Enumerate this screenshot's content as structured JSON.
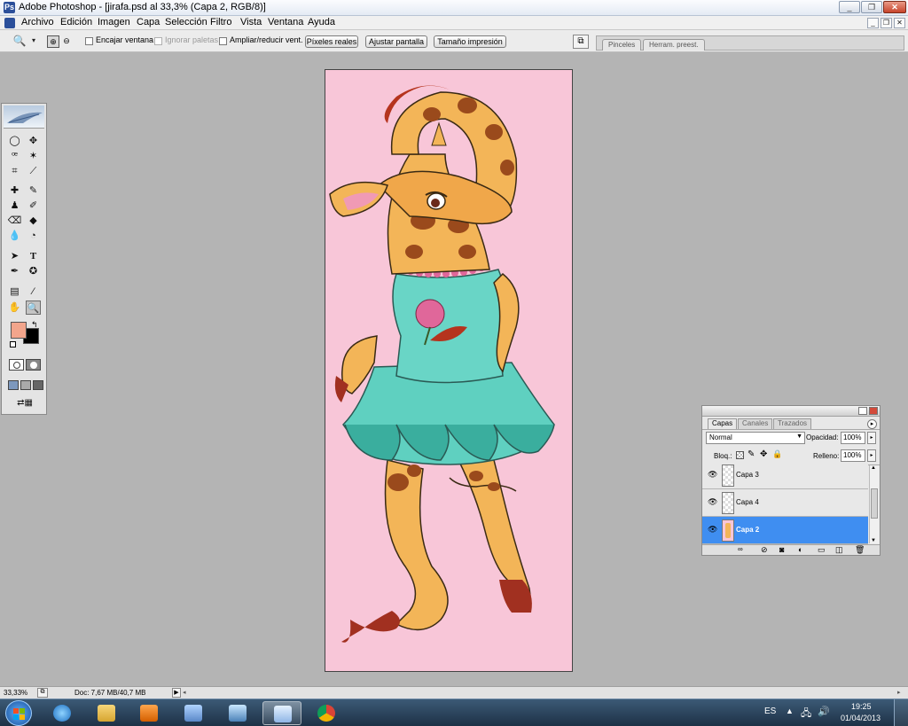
{
  "window": {
    "title": "Adobe Photoshop - [jirafa.psd al 33,3% (Capa 2, RGB/8)]",
    "buttons": {
      "minimize": "_",
      "restore": "❐",
      "close": "✕"
    }
  },
  "menubar": {
    "items": [
      "Archivo",
      "Edición",
      "Imagen",
      "Capa",
      "Selección",
      "Filtro",
      "Vista",
      "Ventana",
      "Ayuda"
    ],
    "doc_buttons": {
      "minimize": "_",
      "restore": "❐",
      "close": "✕"
    }
  },
  "options_bar": {
    "encajar_ventana": "Encajar ventana",
    "ignorar_paletas": "Ignorar paletas",
    "ampliar_reducir": "Ampliar/reducir vent.",
    "pixeles_reales": "Píxeles reales",
    "ajustar_pantalla": "Ajustar pantalla",
    "tamano_impresion": "Tamaño impresión"
  },
  "palette_well": {
    "tabs": [
      "Pinceles",
      "Herram. preest."
    ]
  },
  "layers_panel": {
    "tabs": [
      "Capas",
      "Canales",
      "Trazados"
    ],
    "blend_mode": "Normal",
    "opacity_label": "Opacidad:",
    "opacity_value": "100%",
    "lock_label": "Bloq.:",
    "fill_label": "Relleno:",
    "fill_value": "100%",
    "layers": [
      {
        "name": "Capa 3",
        "selected": false
      },
      {
        "name": "Capa 4",
        "selected": false
      },
      {
        "name": "Capa 2",
        "selected": true
      }
    ]
  },
  "colors": {
    "foreground": "#f2a58c",
    "background": "#000000",
    "canvas_bg": "#f8c6d8",
    "selection": "#3f8ef1"
  },
  "statusbar": {
    "zoom": "33,33%",
    "doc_info": "Doc: 7,67 MB/40,7 MB"
  },
  "taskbar": {
    "language": "ES",
    "time": "19:25",
    "date": "01/04/2013"
  }
}
